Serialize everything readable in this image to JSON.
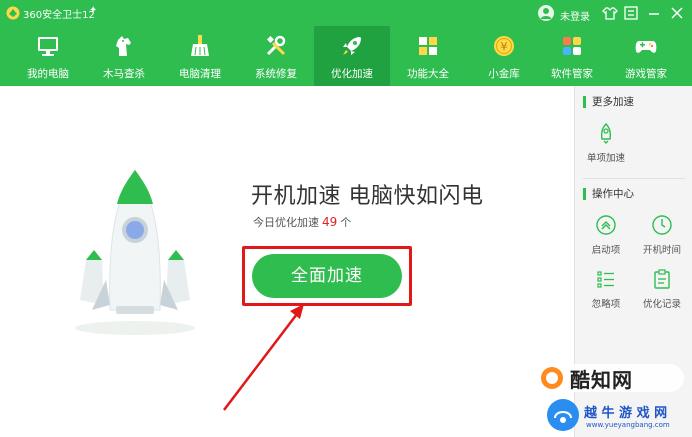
{
  "window": {
    "title": "360安全卫士12",
    "login_text": "未登录"
  },
  "nav": {
    "items": [
      {
        "label": "我的电脑",
        "icon": "monitor-icon"
      },
      {
        "label": "木马查杀",
        "icon": "horse-icon"
      },
      {
        "label": "电脑清理",
        "icon": "broom-icon"
      },
      {
        "label": "系统修复",
        "icon": "tools-icon"
      },
      {
        "label": "优化加速",
        "icon": "rocket-icon"
      },
      {
        "label": "功能大全",
        "icon": "grid-icon"
      },
      {
        "label": "小金库",
        "icon": "coin-icon"
      },
      {
        "label": "软件管家",
        "icon": "apps-icon"
      },
      {
        "label": "游戏管家",
        "icon": "gamepad-icon"
      }
    ],
    "active": "优化加速",
    "coin_symbol": "¥"
  },
  "main": {
    "headline": "开机加速 电脑快如闪电",
    "today_prefix": "今日优化加速",
    "today_count": "49",
    "today_suffix": "个",
    "speedup_button": "全面加速"
  },
  "side": {
    "more_title": "更多加速",
    "single_item": "单项加速",
    "ops_title": "操作中心",
    "ops_items": [
      "启动项",
      "开机时间",
      "忽略项",
      "优化记录"
    ]
  },
  "watermark": {
    "brand": "酷知网",
    "brand2": "越 牛 游 戏 网",
    "url": "www.yueyangbang.com"
  },
  "colors": {
    "brand_green": "#2fbd50",
    "active_green": "#1fa23f",
    "highlight_red": "#e01818"
  }
}
